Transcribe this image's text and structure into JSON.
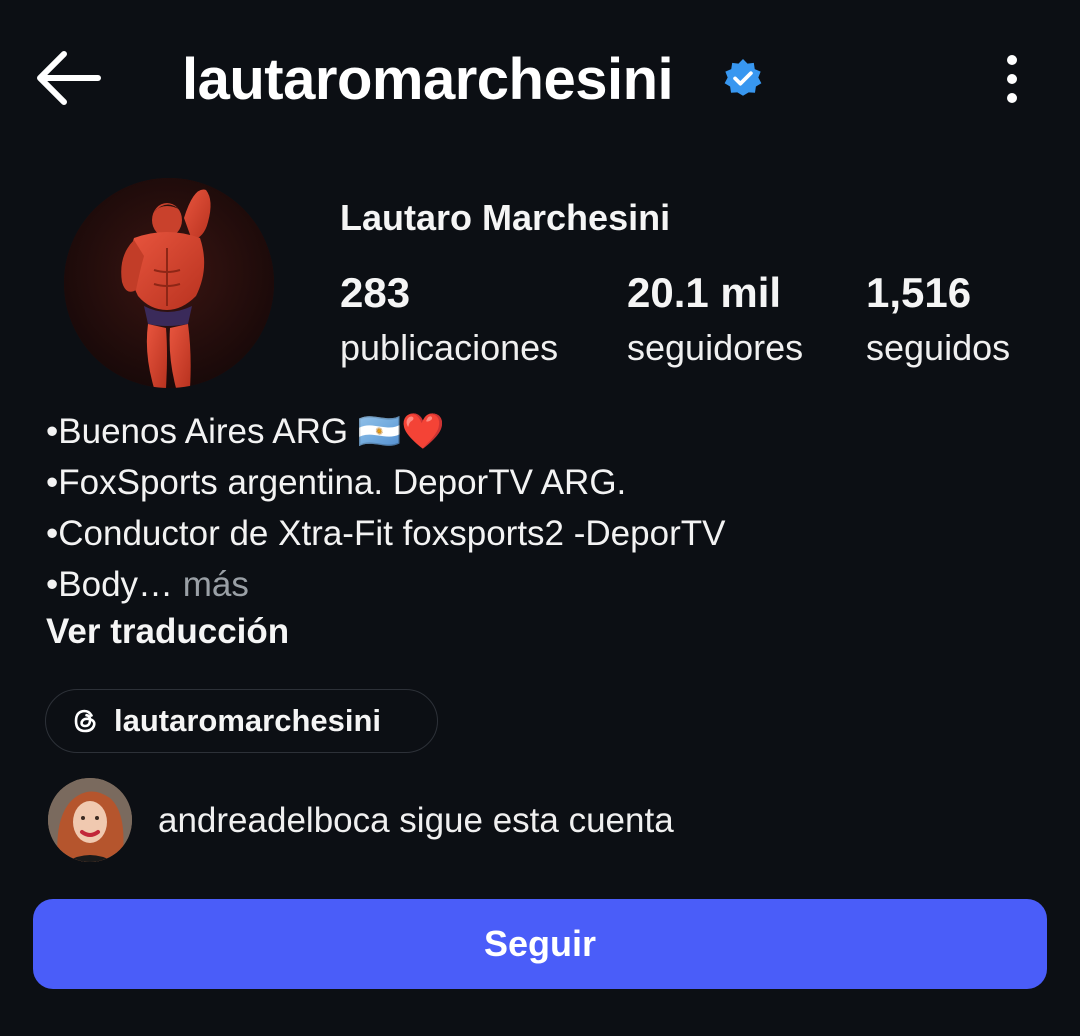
{
  "header": {
    "username": "lautaromarchesini",
    "back_icon": "arrow-left-icon",
    "verified_icon": "verified-badge-icon",
    "more_icon": "more-vertical-icon"
  },
  "profile": {
    "display_name": "Lautaro Marchesini",
    "avatar_icon": "profile-avatar"
  },
  "stats": [
    {
      "value": "283",
      "label": "publicaciones"
    },
    {
      "value": "20.1 mil",
      "label": "seguidores"
    },
    {
      "value": "1,516",
      "label": "seguidos"
    }
  ],
  "bio": {
    "lines": [
      "•Buenos Aires ARG 🇦🇷❤️",
      "•FoxSports argentina. DeporTV ARG.",
      "•Conductor de Xtra-Fit  foxsports2 -DeporTV",
      "•Body…"
    ],
    "more_label": "más",
    "translate_label": "Ver traducción"
  },
  "threads": {
    "icon": "threads-icon",
    "handle": "lautaromarchesini"
  },
  "followed_by": {
    "text": "andreadelboca sigue esta cuenta"
  },
  "actions": {
    "follow_label": "Seguir"
  },
  "colors": {
    "background": "#0c0f14",
    "verified": "#3897f0",
    "follow_button": "#4a5df9",
    "muted_text": "#9aa0a6"
  }
}
